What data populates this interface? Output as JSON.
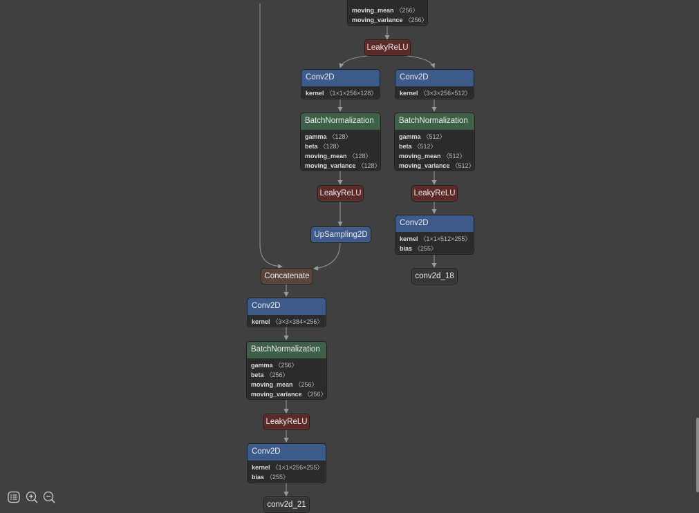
{
  "graph": {
    "bn_top": {
      "attrs": [
        {
          "name": "moving_mean",
          "value": "〈256〉"
        },
        {
          "name": "moving_variance",
          "value": "〈256〉"
        }
      ]
    },
    "relu_top": {
      "label": "LeakyReLU"
    },
    "conv_a": {
      "label": "Conv2D",
      "attrs": [
        {
          "name": "kernel",
          "value": "〈1×1×256×128〉"
        }
      ]
    },
    "bn_a": {
      "label": "BatchNormalization",
      "attrs": [
        {
          "name": "gamma",
          "value": "〈128〉"
        },
        {
          "name": "beta",
          "value": "〈128〉"
        },
        {
          "name": "moving_mean",
          "value": "〈128〉"
        },
        {
          "name": "moving_variance",
          "value": "〈128〉"
        }
      ]
    },
    "relu_a": {
      "label": "LeakyReLU"
    },
    "upsample": {
      "label": "UpSampling2D"
    },
    "conv_b": {
      "label": "Conv2D",
      "attrs": [
        {
          "name": "kernel",
          "value": "〈3×3×256×512〉"
        }
      ]
    },
    "bn_b": {
      "label": "BatchNormalization",
      "attrs": [
        {
          "name": "gamma",
          "value": "〈512〉"
        },
        {
          "name": "beta",
          "value": "〈512〉"
        },
        {
          "name": "moving_mean",
          "value": "〈512〉"
        },
        {
          "name": "moving_variance",
          "value": "〈512〉"
        }
      ]
    },
    "relu_b": {
      "label": "LeakyReLU"
    },
    "conv_b2": {
      "label": "Conv2D",
      "attrs": [
        {
          "name": "kernel",
          "value": "〈1×1×512×255〉"
        },
        {
          "name": "bias",
          "value": "〈255〉"
        }
      ]
    },
    "out_18": {
      "label": "conv2d_18"
    },
    "concat": {
      "label": "Concatenate"
    },
    "conv_c": {
      "label": "Conv2D",
      "attrs": [
        {
          "name": "kernel",
          "value": "〈3×3×384×256〉"
        }
      ]
    },
    "bn_c": {
      "label": "BatchNormalization",
      "attrs": [
        {
          "name": "gamma",
          "value": "〈256〉"
        },
        {
          "name": "beta",
          "value": "〈256〉"
        },
        {
          "name": "moving_mean",
          "value": "〈256〉"
        },
        {
          "name": "moving_variance",
          "value": "〈256〉"
        }
      ]
    },
    "relu_c": {
      "label": "LeakyReLU"
    },
    "conv_c2": {
      "label": "Conv2D",
      "attrs": [
        {
          "name": "kernel",
          "value": "〈1×1×256×255〉"
        },
        {
          "name": "bias",
          "value": "〈255〉"
        }
      ]
    },
    "out_21": {
      "label": "conv2d_21"
    }
  },
  "toolbar": {
    "icons": [
      "list-icon",
      "zoom-in-icon",
      "zoom-out-icon"
    ]
  },
  "colors": {
    "background": "#404040",
    "conv": "#3c5a8a",
    "batchnorm": "#3e6049",
    "activation": "#5b2a28",
    "concat": "#5a453c",
    "edge": "#9a9a9a"
  }
}
